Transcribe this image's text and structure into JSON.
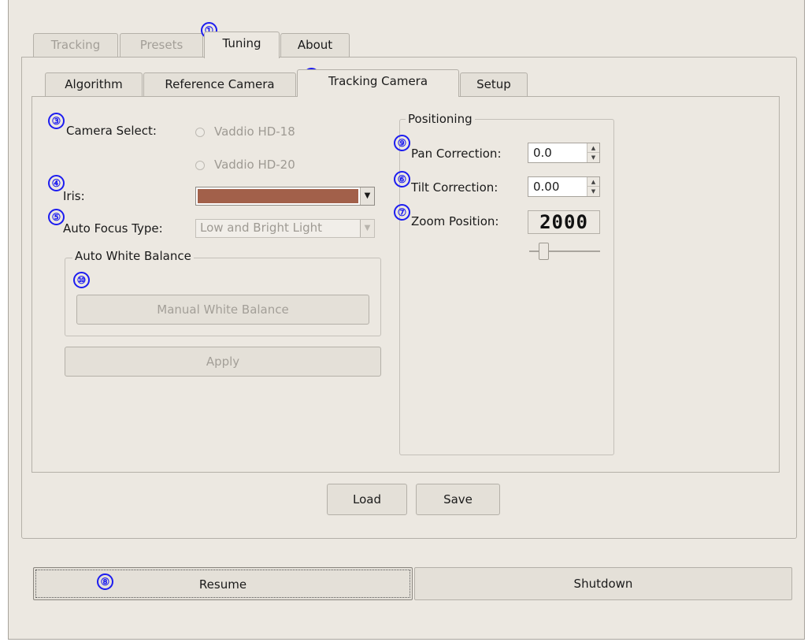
{
  "top_tabs": [
    "Tracking",
    "Presets",
    "Tuning",
    "About"
  ],
  "sub_tabs": [
    "Algorithm",
    "Reference Camera",
    "Tracking Camera",
    "Setup"
  ],
  "camera_select": {
    "label": "Camera Select:",
    "options": [
      "Vaddio HD-18",
      "Vaddio HD-20"
    ]
  },
  "iris": {
    "label": "Iris:",
    "swatch_color": "#a2604a"
  },
  "auto_focus": {
    "label": "Auto Focus Type:",
    "value": "Low and Bright Light"
  },
  "white_balance": {
    "group_title": "Auto White Balance",
    "manual_button": "Manual White Balance"
  },
  "apply_button": "Apply",
  "positioning": {
    "group_title": "Positioning",
    "pan_label": "Pan Correction:",
    "pan_value": "0.0",
    "tilt_label": "Tilt Correction:",
    "tilt_value": "0.00",
    "zoom_label": "Zoom Position:",
    "zoom_value": "2000"
  },
  "load_button": "Load",
  "save_button": "Save",
  "resume_button": "Resume",
  "shutdown_button": "Shutdown",
  "markers": [
    "①",
    "②",
    "③",
    "④",
    "⑤",
    "⑥",
    "⑦",
    "⑧",
    "⑨",
    "⑩"
  ],
  "marker_color": "#1c1cf0"
}
